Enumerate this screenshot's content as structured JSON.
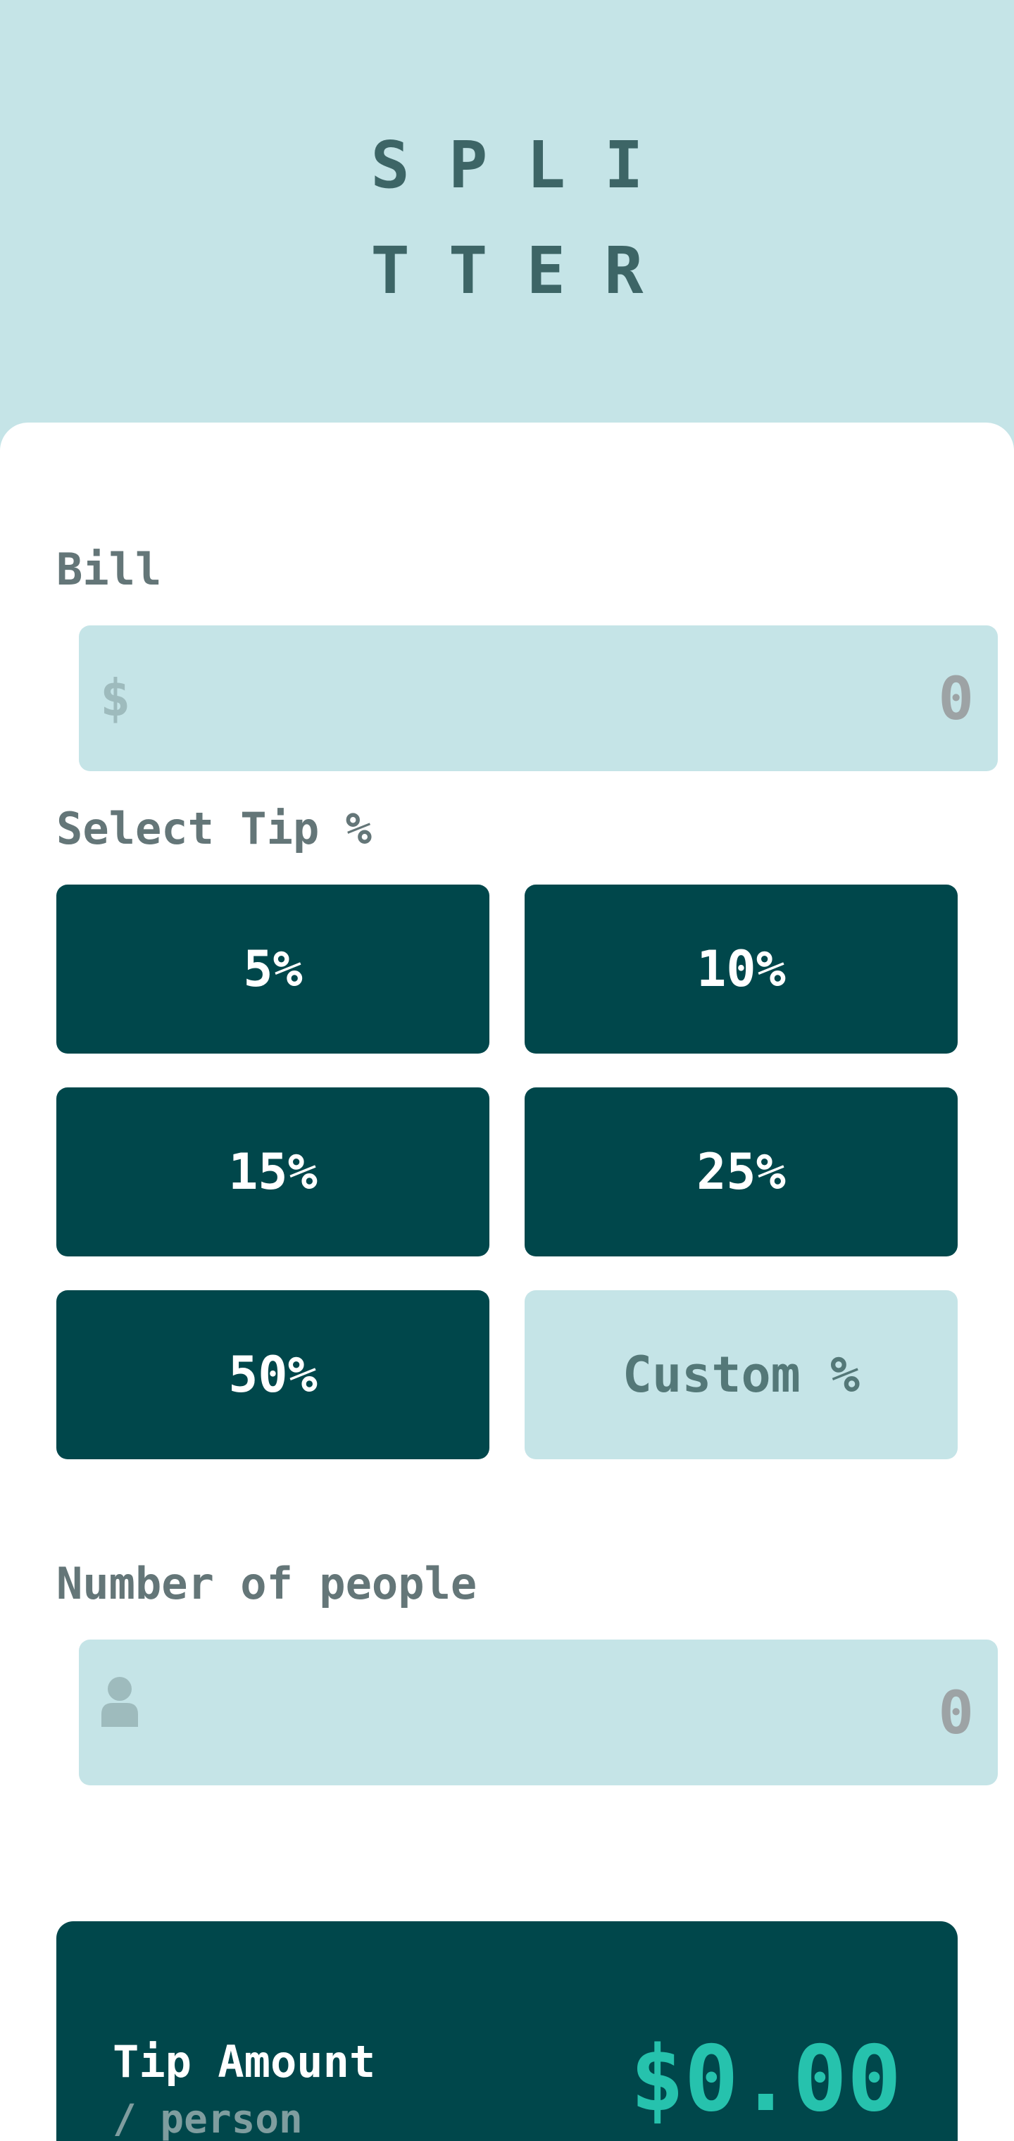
{
  "logo": {
    "line1": "SPLI",
    "line2": "TTER"
  },
  "bill": {
    "label": "Bill",
    "currency_symbol": "$",
    "placeholder": "0",
    "value": ""
  },
  "tip": {
    "label": "Select Tip %",
    "options": [
      "5%",
      "10%",
      "15%",
      "25%",
      "50%"
    ],
    "custom_placeholder": "Custom %"
  },
  "people": {
    "label": "Number of people",
    "icon": "person-icon",
    "placeholder": "0",
    "value": ""
  },
  "result": {
    "tip_label": "Tip Amount",
    "tip_sublabel": "/ person",
    "tip_value": "$0.00"
  },
  "colors": {
    "background": "#c5e4e7",
    "dark_cyan": "#00474b",
    "accent": "#26c2ad",
    "card": "#ffffff"
  }
}
